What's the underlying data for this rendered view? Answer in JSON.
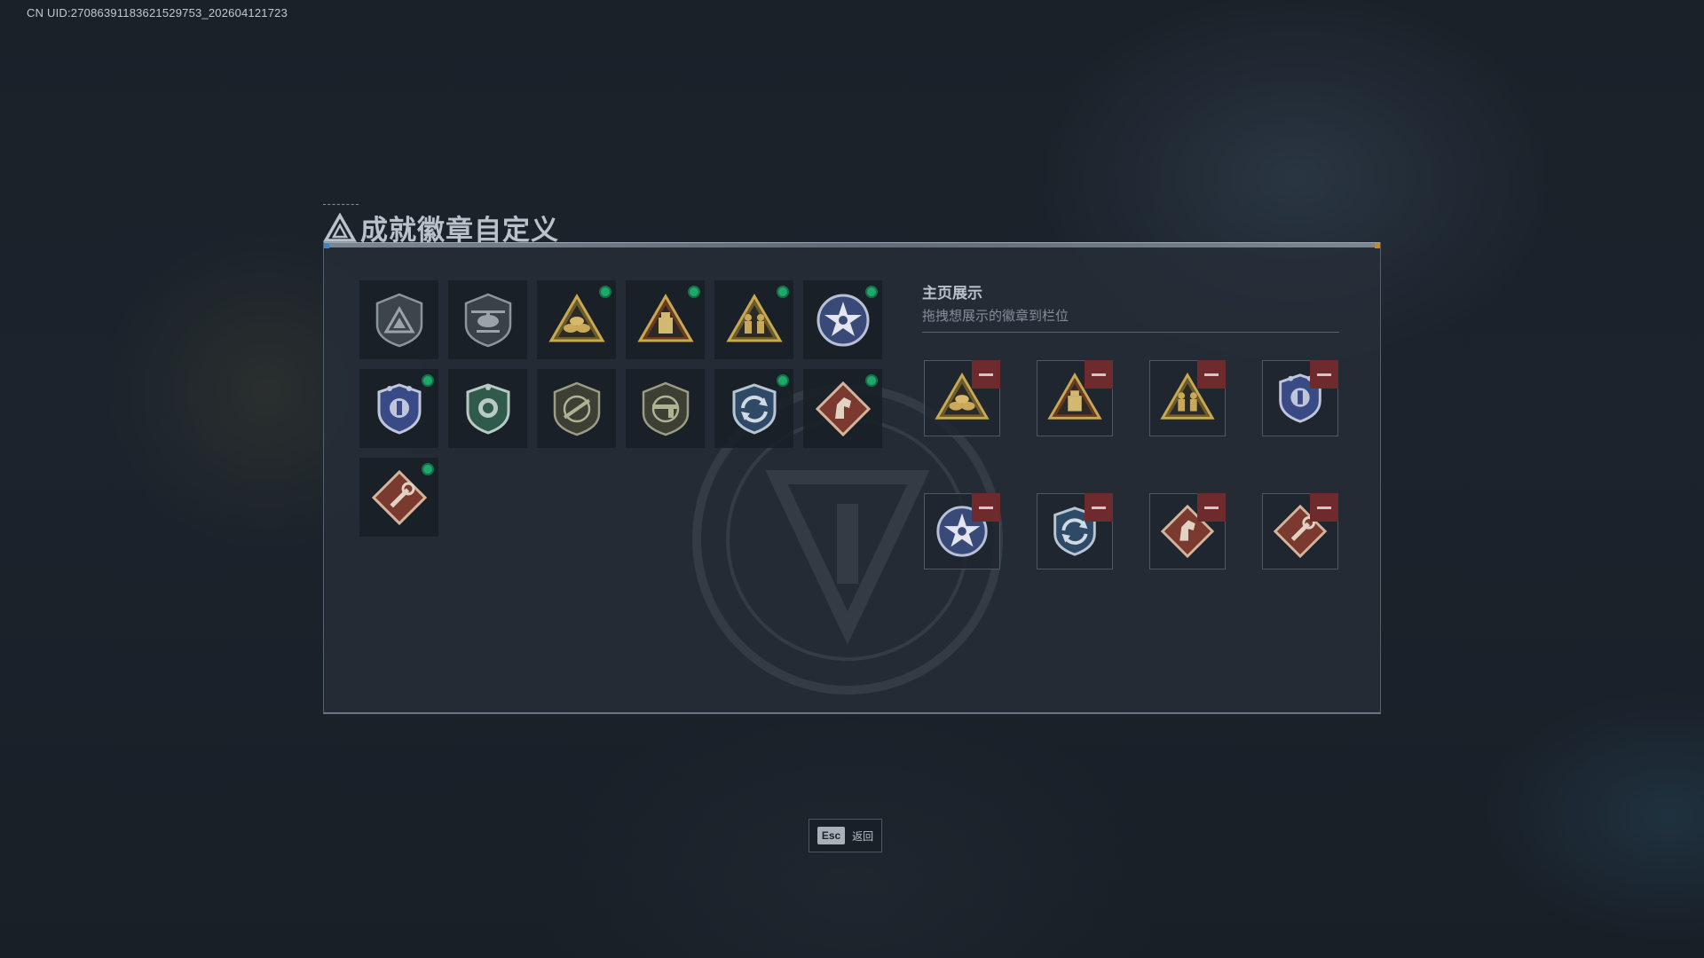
{
  "uid_text": "CN UID:2708639118362152​9753_202604121723",
  "title": "成就徽章自定义",
  "badges": [
    {
      "icon": "triangle-shield-badge-icon",
      "new": false
    },
    {
      "icon": "helicopter-shield-badge-icon",
      "new": false
    },
    {
      "icon": "sandbag-triangle-badge-icon",
      "new": true
    },
    {
      "icon": "crate-triangle-badge-icon",
      "new": true
    },
    {
      "icon": "soldiers-triangle-badge-icon",
      "new": true
    },
    {
      "icon": "star-round-badge-icon",
      "new": true
    },
    {
      "icon": "blue-crest-badge-icon",
      "new": true
    },
    {
      "icon": "green-crest-badge-icon",
      "new": false
    },
    {
      "icon": "rifle-shield-badge-icon",
      "new": false
    },
    {
      "icon": "pistol-shield-badge-icon",
      "new": false
    },
    {
      "icon": "rotation-crest-badge-icon",
      "new": true
    },
    {
      "icon": "horse-diamond-badge-icon",
      "new": true
    },
    {
      "icon": "wrench-diamond-badge-icon",
      "new": true
    }
  ],
  "showcase": {
    "title": "主页展示",
    "subtitle": "拖拽想展示的徽章到栏位",
    "slots": [
      {
        "icon": "sandbag-triangle-badge-icon"
      },
      {
        "icon": "crate-triangle-badge-icon"
      },
      {
        "icon": "soldiers-triangle-badge-icon"
      },
      {
        "icon": "blue-crest-badge-icon"
      },
      {
        "icon": "star-round-badge-icon"
      },
      {
        "icon": "rotation-crest-badge-icon"
      },
      {
        "icon": "horse-diamond-badge-icon"
      },
      {
        "icon": "wrench-diamond-badge-icon"
      }
    ]
  },
  "footer": {
    "esc_key": "Esc",
    "back_label": "返回"
  },
  "colors": {
    "new_dot": "#1ea86a",
    "remove": "#6e2a2c",
    "panel_accent_left": "#3a86c8",
    "panel_accent_right": "#c8892e"
  }
}
